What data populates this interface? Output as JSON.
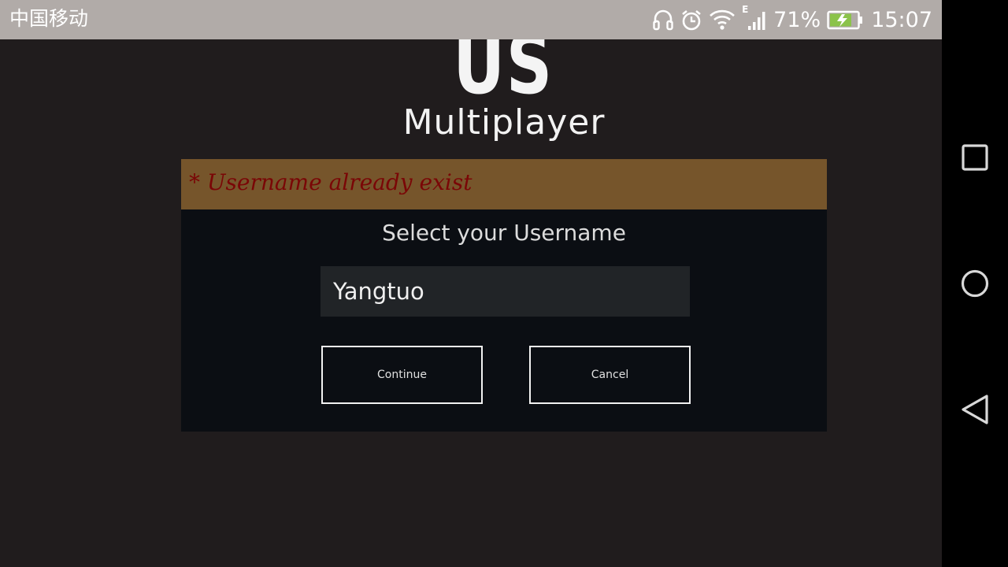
{
  "status_bar": {
    "carrier": "中国移动",
    "network_type": "E",
    "battery_percent": "71%",
    "time": "15:07",
    "icons": [
      "headset-icon",
      "alarm-icon",
      "wifi-icon",
      "signal-icon",
      "battery-charging-icon"
    ]
  },
  "game": {
    "title": "AFTER US",
    "subtitle": "Multiplayer"
  },
  "dialog": {
    "error_message": "* Username already exist",
    "title": "Select your Username",
    "username_value": "Yangtuo",
    "continue_label": "Continue",
    "cancel_label": "Cancel"
  },
  "nav_bar": {
    "buttons": [
      "recents-icon",
      "home-icon",
      "back-icon"
    ]
  },
  "colors": {
    "status_bar_bg": "#b1aba8",
    "screen_bg": "#201c1d",
    "error_banner_bg": "#76552b",
    "error_text": "#7a0606",
    "dialog_bg": "#0b0e13",
    "input_bg": "#212427",
    "battery_fill": "#8bc34a"
  }
}
